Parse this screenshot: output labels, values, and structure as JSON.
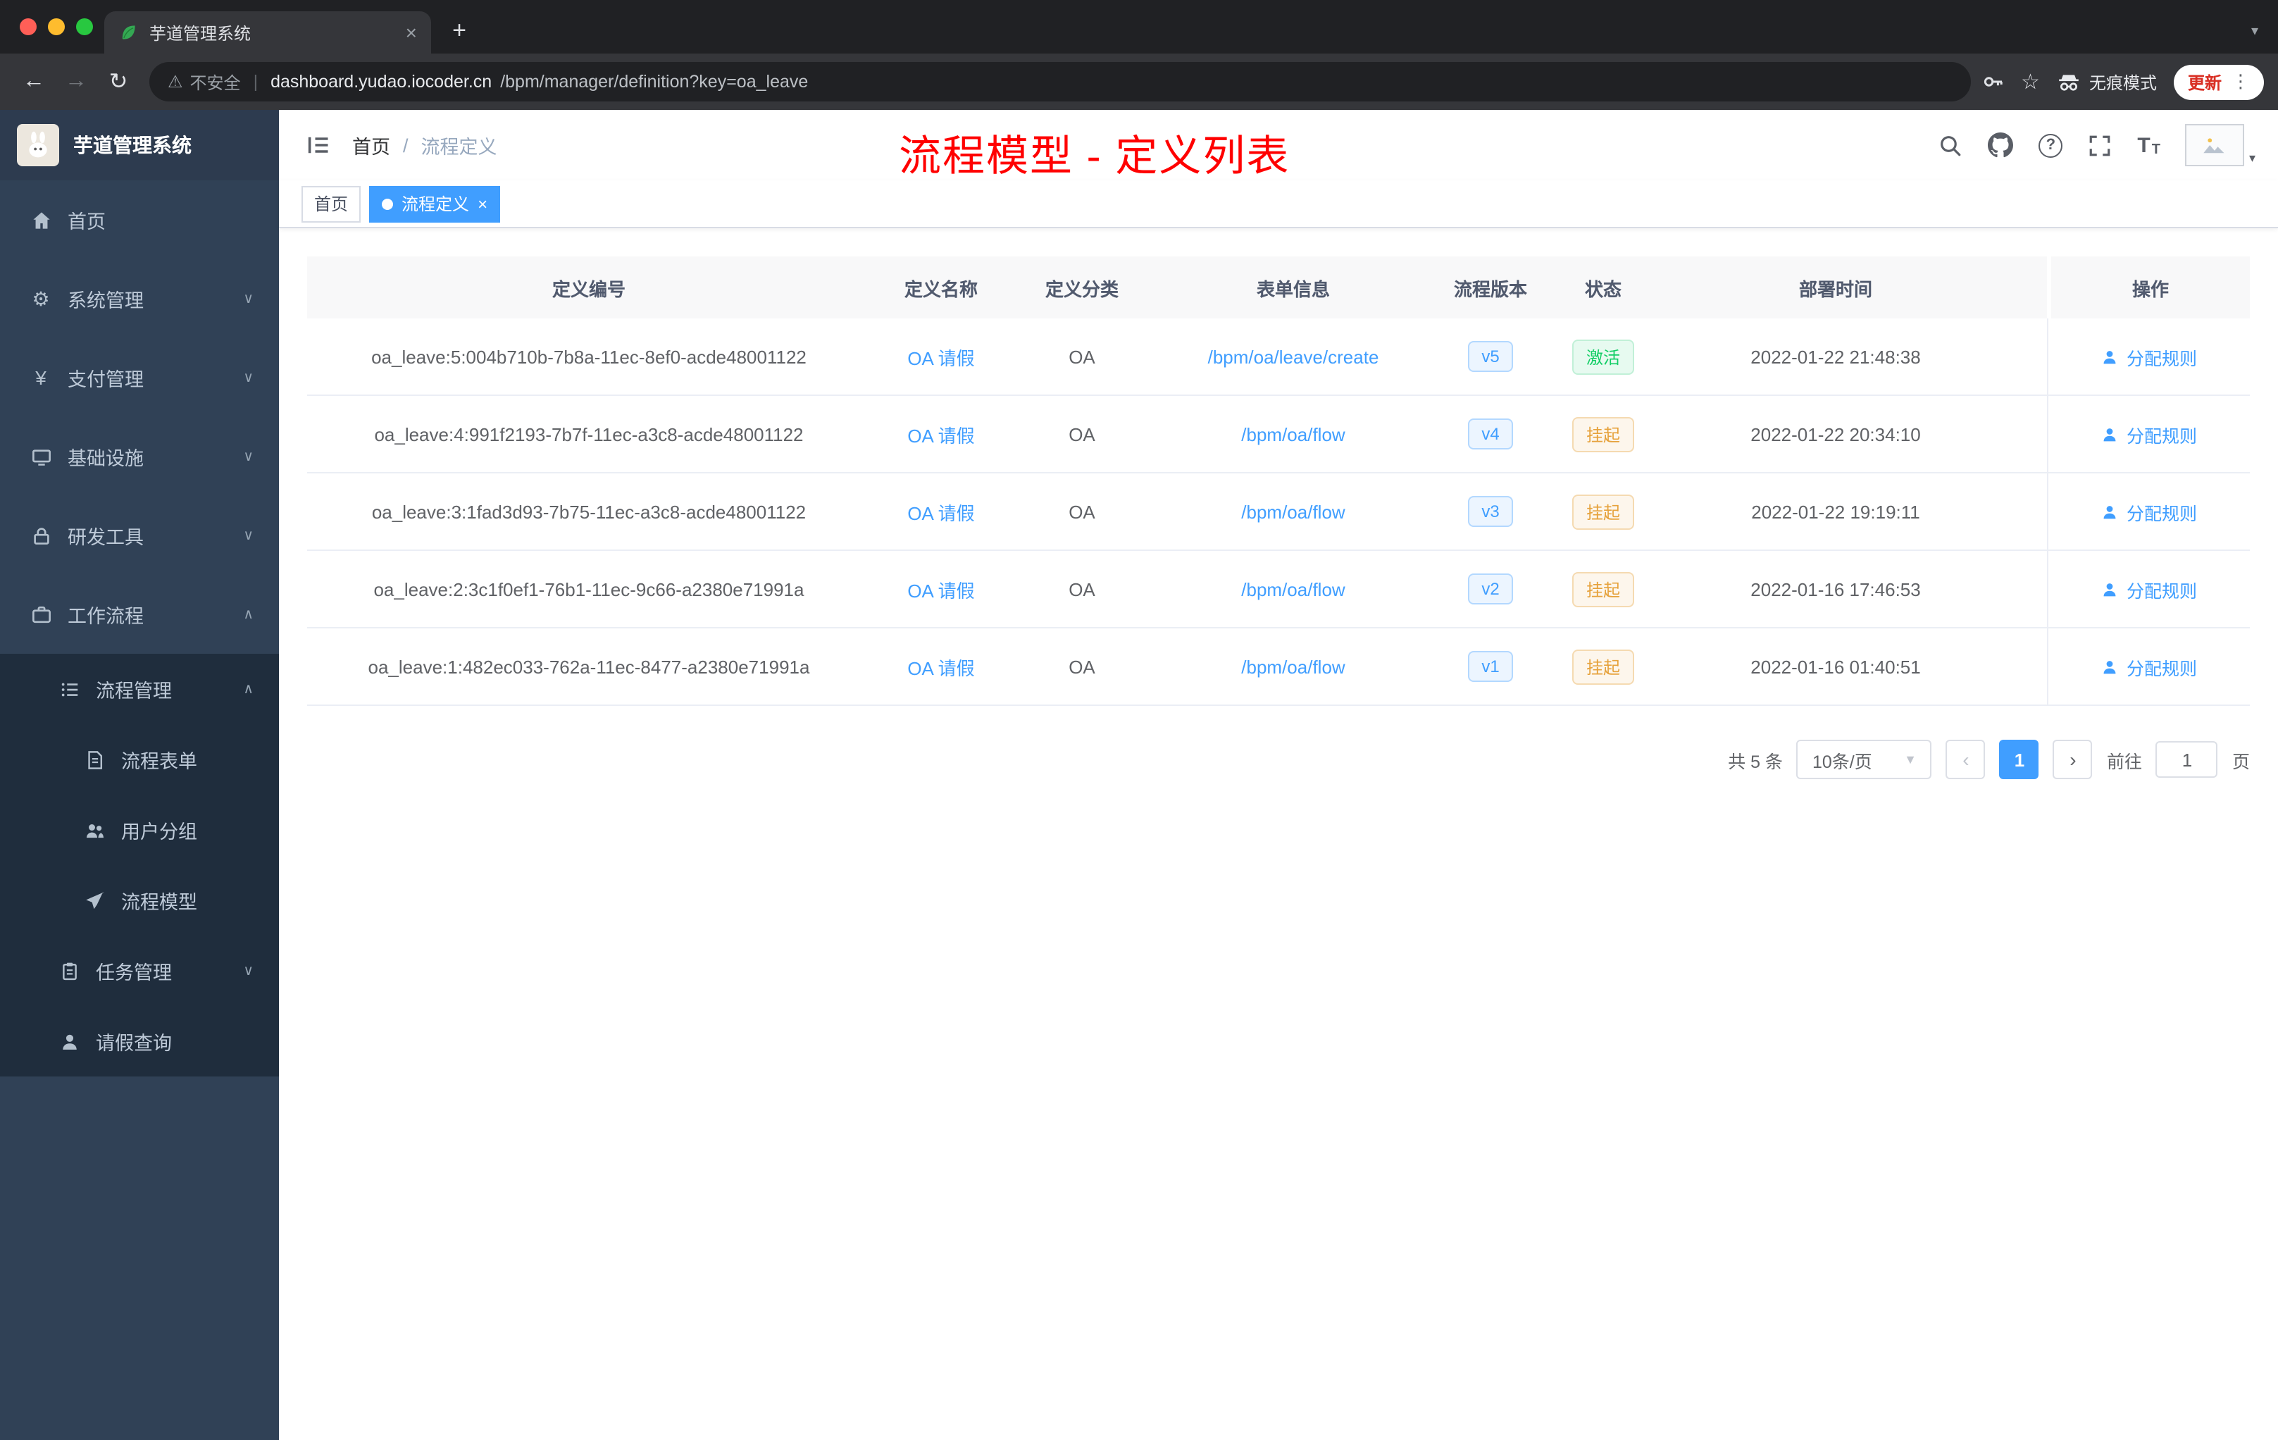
{
  "colors": {
    "accent": "#409eff",
    "success": "#13ce66",
    "warning": "#e6a23c",
    "annotation": "#ff0000",
    "sidebar_bg": "#304156",
    "submenu_bg": "#1f2d3d"
  },
  "icons": {
    "close": "×",
    "plus": "+",
    "tab_menu": "▾",
    "back": "←",
    "forward": "→",
    "reload": "↻",
    "warning": "⚠",
    "divider": "|",
    "star": "☆",
    "more": "⋮",
    "menu_collapsed": "∨",
    "menu_expanded": "∧",
    "breadcrumb_separator": "/",
    "question": "?",
    "yen": "¥",
    "gear": "⚙",
    "select_caret": "▼",
    "prev": "‹",
    "next": "›",
    "avatar_caret": "▾",
    "font_large": "T",
    "font_small": "T",
    "tag_close": "×"
  },
  "browser": {
    "tab_title": "芋道管理系统",
    "security_label": "不安全",
    "url_domain": "dashboard.yudao.iocoder.cn",
    "url_path": "/bpm/manager/definition?key=oa_leave",
    "incognito_label": "无痕模式",
    "update_label": "更新"
  },
  "sidebar": {
    "logo_title": "芋道管理系统",
    "items": [
      {
        "label": "首页"
      },
      {
        "label": "系统管理"
      },
      {
        "label": "支付管理"
      },
      {
        "label": "基础设施"
      },
      {
        "label": "研发工具"
      },
      {
        "label": "工作流程"
      },
      {
        "label": "流程管理"
      },
      {
        "label": "流程表单"
      },
      {
        "label": "用户分组"
      },
      {
        "label": "流程模型"
      },
      {
        "label": "任务管理"
      },
      {
        "label": "请假查询"
      }
    ]
  },
  "header": {
    "breadcrumb_home": "首页",
    "breadcrumb_current": "流程定义",
    "annotation": "流程模型 - 定义列表"
  },
  "tags": {
    "home": "首页",
    "active": "流程定义"
  },
  "table": {
    "columns": [
      "定义编号",
      "定义名称",
      "定义分类",
      "表单信息",
      "流程版本",
      "状态",
      "部署时间",
      "操作"
    ],
    "rows": [
      {
        "id": "oa_leave:5:004b710b-7b8a-11ec-8ef0-acde48001122",
        "name": "OA 请假",
        "category": "OA",
        "form": "/bpm/oa/leave/create",
        "version": "v5",
        "status": "激活",
        "time": "2022-01-22 21:48:38",
        "action": "分配规则"
      },
      {
        "id": "oa_leave:4:991f2193-7b7f-11ec-a3c8-acde48001122",
        "name": "OA 请假",
        "category": "OA",
        "form": "/bpm/oa/flow",
        "version": "v4",
        "status": "挂起",
        "time": "2022-01-22 20:34:10",
        "action": "分配规则"
      },
      {
        "id": "oa_leave:3:1fad3d93-7b75-11ec-a3c8-acde48001122",
        "name": "OA 请假",
        "category": "OA",
        "form": "/bpm/oa/flow",
        "version": "v3",
        "status": "挂起",
        "time": "2022-01-22 19:19:11",
        "action": "分配规则"
      },
      {
        "id": "oa_leave:2:3c1f0ef1-76b1-11ec-9c66-a2380e71991a",
        "name": "OA 请假",
        "category": "OA",
        "form": "/bpm/oa/flow",
        "version": "v2",
        "status": "挂起",
        "time": "2022-01-16 17:46:53",
        "action": "分配规则"
      },
      {
        "id": "oa_leave:1:482ec033-762a-11ec-8477-a2380e71991a",
        "name": "OA 请假",
        "category": "OA",
        "form": "/bpm/oa/flow",
        "version": "v1",
        "status": "挂起",
        "time": "2022-01-16 01:40:51",
        "action": "分配规则"
      }
    ]
  },
  "pagination": {
    "total": "共 5 条",
    "page_size": "10条/页",
    "current_page": "1",
    "goto_label": "前往",
    "goto_value": "1",
    "goto_unit": "页"
  }
}
